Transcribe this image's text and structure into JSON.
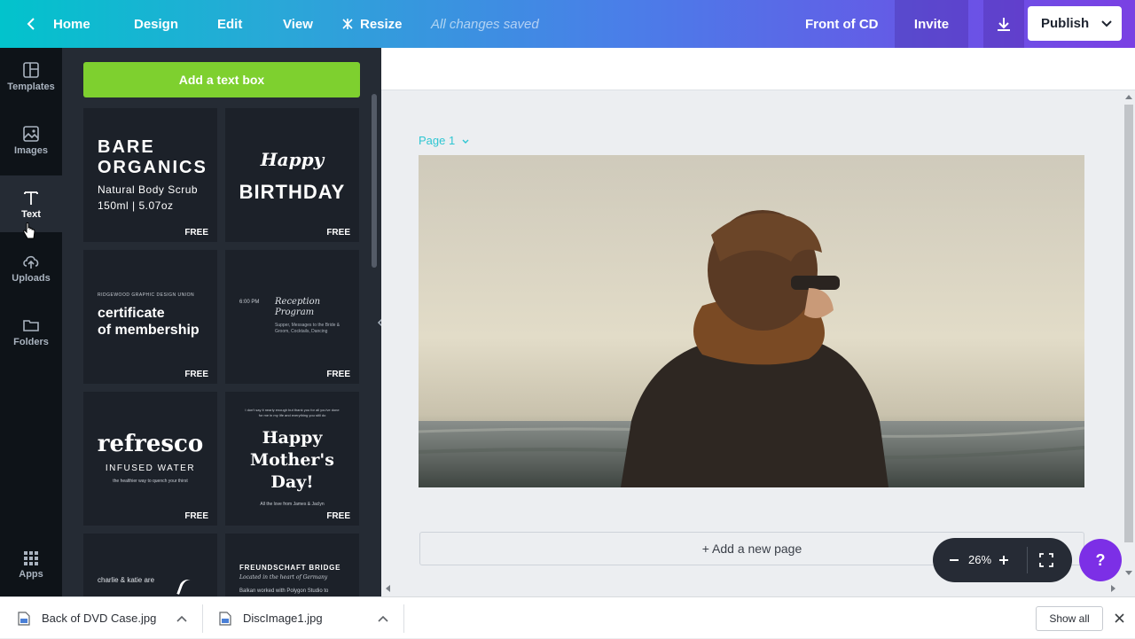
{
  "topbar": {
    "home": "Home",
    "menu": [
      "Design",
      "Edit",
      "View"
    ],
    "resize": "Resize",
    "saved": "All changes saved",
    "doc_title": "Front of CD",
    "invite": "Invite",
    "publish": "Publish"
  },
  "rail": {
    "templates": "Templates",
    "images": "Images",
    "text": "Text",
    "uploads": "Uploads",
    "folders": "Folders",
    "apps": "Apps"
  },
  "panel": {
    "add_text": "Add a text box",
    "free": "FREE",
    "t1": {
      "line1": "BARE",
      "line2": "ORGANICS",
      "line3": "Natural Body Scrub",
      "line4": "150ml | 5.07oz"
    },
    "t2": {
      "line1": "Happy",
      "line2": "BIRTHDAY"
    },
    "t3": {
      "line1": "RIDGEWOOD GRAPHIC DESIGN UNION",
      "line2": "certificate",
      "line3": "of membership"
    },
    "t4": {
      "time": "6:00 PM",
      "line1": "Reception",
      "line2": "Program",
      "line3": "Supper, Messages to the Bride &",
      "line4": "Groom, Cocktails, Dancing"
    },
    "t5": {
      "line1": "refresco",
      "line2": "INFUSED WATER",
      "line3": "the healthier way to quench your thirst"
    },
    "t6": {
      "top": "I don't say it nearly enough but thank you for all you've done",
      "top2": "for me in my life and everything you still do",
      "line1": "Happy",
      "line2": "Mother's",
      "line3": "Day!",
      "bottom": "All the love from James & Jaclyn"
    },
    "t7": {
      "line1": "charlie & katie are"
    },
    "t8": {
      "line1": "FREUNDSCHAFT BRIDGE",
      "line2": "Located in the heart of Germany",
      "line3": "Balkan worked with Polygon Studio to"
    }
  },
  "canvas": {
    "page_label": "Page 1",
    "add_page": "+ Add a new page",
    "zoom": "26%",
    "help": "?"
  },
  "downloads": {
    "file1": "Back of DVD Case.jpg",
    "file2": "DiscImage1.jpg",
    "show_all": "Show all"
  },
  "colors": {
    "accent_green": "#7ed02f",
    "help_purple": "#7c2fe6",
    "page_label": "#2ec6d2"
  }
}
